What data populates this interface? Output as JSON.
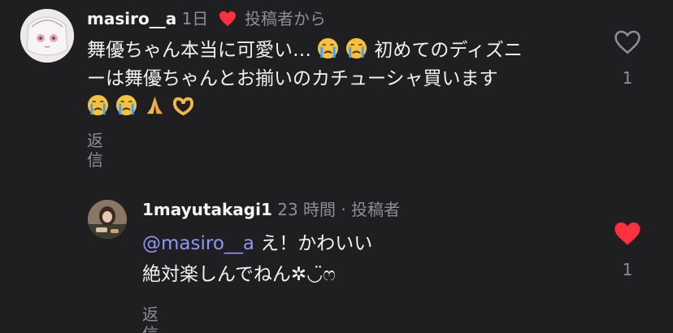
{
  "comments": [
    {
      "username": "masiro__a",
      "time": "1日",
      "creator_label": "投稿者から",
      "text_line1": "舞優ちゃん本当に可愛い…",
      "text_line1b": "初めてのディズニ",
      "text_line2": "ーは舞優ちゃんとお揃いのカチューシャ買います",
      "emoji_line1": [
        "crying-face",
        "crying-face"
      ],
      "emoji_line3": [
        "crying-face",
        "crying-face",
        "folded-hands",
        "heart-hands"
      ],
      "reply_label": "返信",
      "like_count": "1",
      "liked": false
    },
    {
      "username": "1mayutakagi1",
      "time": "23 時間",
      "separator": "·",
      "creator_label": "投稿者",
      "mention": "@masiro__a",
      "text_line1": " え！かわいい",
      "text_line2": "絶対楽しんでねん✲◡̈ෆ",
      "reply_label": "返信",
      "like_count": "1",
      "liked": true
    }
  ],
  "colors": {
    "background": "#1f1f21",
    "muted": "#8e8e93",
    "heart_red": "#ff3040",
    "mention": "#8f96f5"
  }
}
